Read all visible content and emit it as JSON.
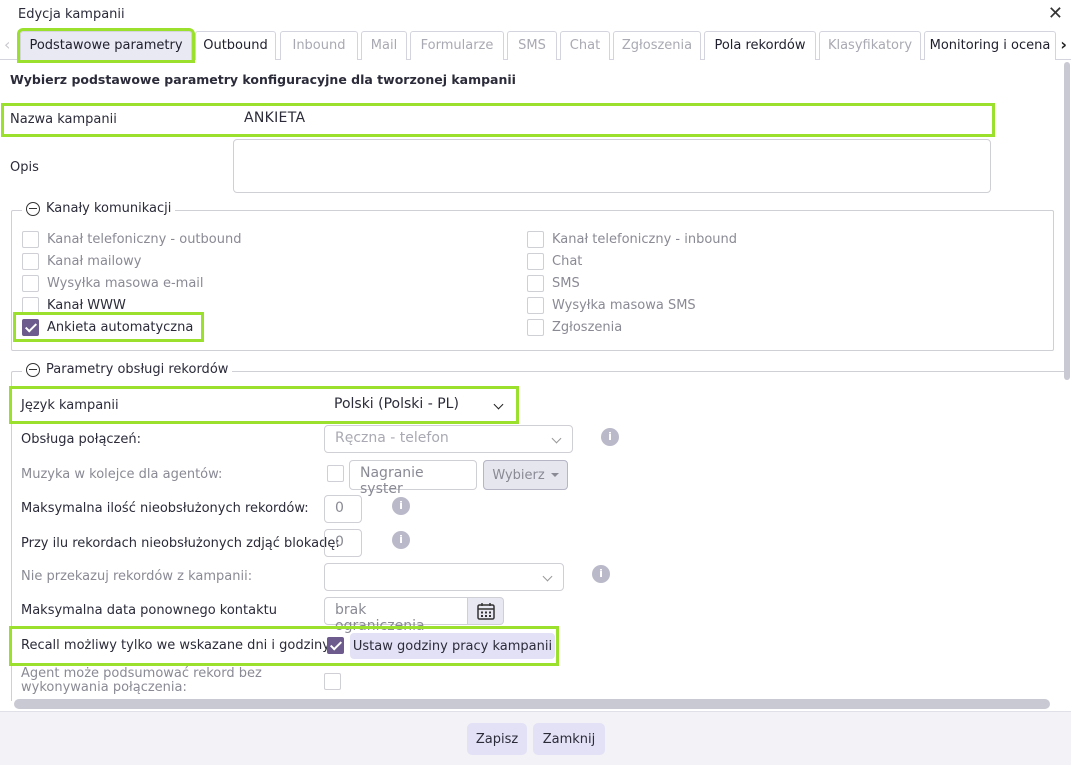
{
  "window": {
    "title": "Edycja kampanii"
  },
  "tabs": [
    {
      "label": "Podstawowe parametry"
    },
    {
      "label": "Outbound"
    },
    {
      "label": "Inbound"
    },
    {
      "label": "Mail"
    },
    {
      "label": "Formularze"
    },
    {
      "label": "SMS"
    },
    {
      "label": "Chat"
    },
    {
      "label": "Zgłoszenia"
    },
    {
      "label": "Pola rekordów"
    },
    {
      "label": "Klasyfikatory"
    },
    {
      "label": "Monitoring i ocena"
    }
  ],
  "intro": "Wybierz podstawowe parametry konfiguracyjne dla tworzonej kampanii",
  "campaign_name": {
    "label": "Nazwa kampanii",
    "value": "ANKIETA"
  },
  "description": {
    "label": "Opis",
    "value": ""
  },
  "channels": {
    "legend": "Kanały komunikacji",
    "left": [
      {
        "label": "Kanał telefoniczny - outbound",
        "checked": false
      },
      {
        "label": "Kanał mailowy",
        "checked": false
      },
      {
        "label": "Wysyłka masowa e-mail",
        "checked": false
      },
      {
        "label": "Kanał WWW",
        "checked": false
      },
      {
        "label": "Ankieta automatyczna",
        "checked": true
      }
    ],
    "right": [
      {
        "label": "Kanał telefoniczny - inbound",
        "checked": false
      },
      {
        "label": "Chat",
        "checked": false
      },
      {
        "label": "SMS",
        "checked": false
      },
      {
        "label": "Wysyłka masowa SMS",
        "checked": false
      },
      {
        "label": "Zgłoszenia",
        "checked": false
      }
    ]
  },
  "params": {
    "legend": "Parametry obsługi rekordów",
    "language": {
      "label": "Język kampanii",
      "value": "Polski (Polski - PL)"
    },
    "call_handling": {
      "label": "Obsługa połączeń:",
      "value": "Ręczna - telefon"
    },
    "queue_music": {
      "label": "Muzyka w kolejce dla agentów:",
      "value": "Nagranie syster",
      "button": "Wybierz"
    },
    "max_unhandled": {
      "label": "Maksymalna ilość nieobsłużonych rekordów:",
      "value": "0"
    },
    "unblock_at": {
      "label": "Przy ilu rekordach nieobsłużonych zdjąć blokadę:",
      "value": "0"
    },
    "no_transfer": {
      "label": "Nie przekazuj rekordów z kampanii:",
      "value": ""
    },
    "max_date": {
      "label": "Maksymalna data ponownego kontaktu",
      "value": "brak ograniczenia"
    },
    "recall": {
      "label": "Recall możliwy tylko we wskazane dni i godziny:",
      "checked": true,
      "button": "Ustaw godziny pracy kampanii"
    },
    "agent_summary": {
      "label": "Agent może podsumować rekord bez wykonywania połączenia:",
      "checked": false
    }
  },
  "footer": {
    "save": "Zapisz",
    "close": "Zamknij"
  },
  "colors": {
    "highlight": "#9ae02c",
    "checkbox_checked": "#6c5b8c",
    "button_bg": "#e3e1f5"
  }
}
